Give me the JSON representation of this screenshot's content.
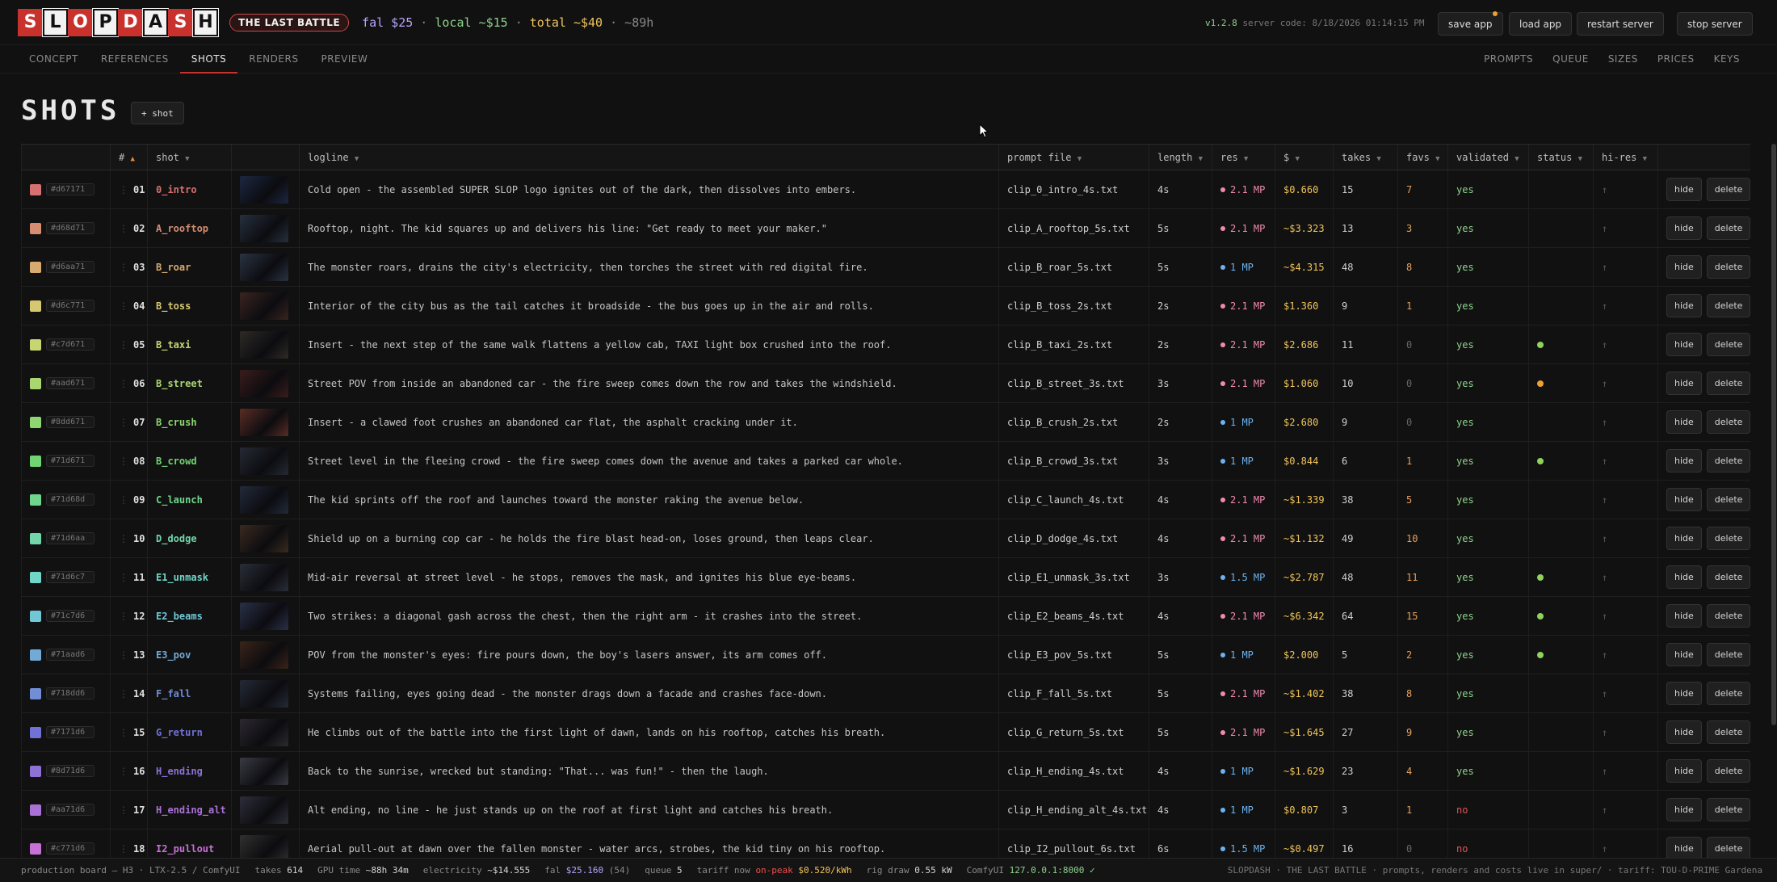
{
  "app": {
    "logo_letters": [
      "S",
      "L",
      "O",
      "P",
      "D",
      "A",
      "S",
      "H"
    ],
    "project_badge": "THE LAST BATTLE",
    "costs": {
      "fal": "fal $25",
      "local": "local ~$15",
      "total": "total ~$40",
      "eta": "~89h"
    },
    "version": "v1.2.8",
    "server_code": "server code: 8/18/2026 01:14:15 PM",
    "buttons": {
      "save": "save app",
      "load": "load app",
      "restart": "restart server",
      "stop": "stop server"
    }
  },
  "nav": {
    "left": [
      "CONCEPT",
      "REFERENCES",
      "SHOTS",
      "RENDERS",
      "PREVIEW"
    ],
    "active": "SHOTS",
    "right": [
      "PROMPTS",
      "QUEUE",
      "SIZES",
      "PRICES",
      "KEYS"
    ]
  },
  "page": {
    "title": "SHOTS",
    "add_button": "+ shot"
  },
  "table": {
    "headers": {
      "num": "#",
      "shot": "shot",
      "logline": "logline",
      "prompt_file": "prompt file",
      "length": "length",
      "res": "res",
      "cost": "$",
      "takes": "takes",
      "favs": "favs",
      "validated": "validated",
      "status": "status",
      "hires": "hi-res"
    },
    "row_buttons": {
      "hide": "hide",
      "delete": "delete"
    },
    "rows": [
      {
        "color": "#d67171",
        "num": "01",
        "shot": "0_intro",
        "thumb": "#1c2740",
        "logline": "Cold open - the assembled SUPER SLOP logo ignites out of the dark, then dissolves into embers.",
        "file": "clip_0_intro_4s.txt",
        "length": "4s",
        "res": "2.1 MP",
        "res_kind": "pink",
        "cost": "$0.660",
        "takes": "15",
        "favs": "7",
        "validated": "yes",
        "status": ""
      },
      {
        "color": "#d68d71",
        "num": "02",
        "shot": "A_rooftop",
        "thumb": "#26303e",
        "logline": "Rooftop, night. The kid squares up and delivers his line: \"Get ready to meet your maker.\"",
        "file": "clip_A_rooftop_5s.txt",
        "length": "5s",
        "res": "2.1 MP",
        "res_kind": "pink",
        "cost": "~$3.323",
        "takes": "13",
        "favs": "3",
        "validated": "yes",
        "status": ""
      },
      {
        "color": "#d6aa71",
        "num": "03",
        "shot": "B_roar",
        "thumb": "#2a3342",
        "logline": "The monster roars, drains the city's electricity, then torches the street with red digital fire.",
        "file": "clip_B_roar_5s.txt",
        "length": "5s",
        "res": "1 MP",
        "res_kind": "blue",
        "cost": "~$4.315",
        "takes": "48",
        "favs": "8",
        "validated": "yes",
        "status": ""
      },
      {
        "color": "#d6c771",
        "num": "04",
        "shot": "B_toss",
        "thumb": "#3a2420",
        "logline": "Interior of the city bus as the tail catches it broadside - the bus goes up in the air and rolls.",
        "file": "clip_B_toss_2s.txt",
        "length": "2s",
        "res": "2.1 MP",
        "res_kind": "pink",
        "cost": "$1.360",
        "takes": "9",
        "favs": "1",
        "validated": "yes",
        "status": ""
      },
      {
        "color": "#c7d671",
        "num": "05",
        "shot": "B_taxi",
        "thumb": "#2e2a26",
        "logline": "Insert - the next step of the same walk flattens a yellow cab, TAXI light box crushed into the roof.",
        "file": "clip_B_taxi_2s.txt",
        "length": "2s",
        "res": "2.1 MP",
        "res_kind": "pink",
        "cost": "$2.686",
        "takes": "11",
        "favs": "0",
        "validated": "yes",
        "status": "#8ed35a"
      },
      {
        "color": "#aad671",
        "num": "06",
        "shot": "B_street",
        "thumb": "#3a1c1c",
        "logline": "Street POV from inside an abandoned car - the fire sweep comes down the row and takes the windshield.",
        "file": "clip_B_street_3s.txt",
        "length": "3s",
        "res": "2.1 MP",
        "res_kind": "pink",
        "cost": "$1.060",
        "takes": "10",
        "favs": "0",
        "validated": "yes",
        "status": "#f0a030"
      },
      {
        "color": "#8dd671",
        "num": "07",
        "shot": "B_crush",
        "thumb": "#5a2c24",
        "logline": "Insert - a clawed foot crushes an abandoned car flat, the asphalt cracking under it.",
        "file": "clip_B_crush_2s.txt",
        "length": "2s",
        "res": "1 MP",
        "res_kind": "blue",
        "cost": "$2.680",
        "takes": "9",
        "favs": "0",
        "validated": "yes",
        "status": ""
      },
      {
        "color": "#71d671",
        "num": "08",
        "shot": "B_crowd",
        "thumb": "#262a34",
        "logline": "Street level in the fleeing crowd - the fire sweep comes down the avenue and takes a parked car whole.",
        "file": "clip_B_crowd_3s.txt",
        "length": "3s",
        "res": "1 MP",
        "res_kind": "blue",
        "cost": "$0.844",
        "takes": "6",
        "favs": "1",
        "validated": "yes",
        "status": "#8ed35a"
      },
      {
        "color": "#71d68d",
        "num": "09",
        "shot": "C_launch",
        "thumb": "#222a3a",
        "logline": "The kid sprints off the roof and launches toward the monster raking the avenue below.",
        "file": "clip_C_launch_4s.txt",
        "length": "4s",
        "res": "2.1 MP",
        "res_kind": "pink",
        "cost": "~$1.339",
        "takes": "38",
        "favs": "5",
        "validated": "yes",
        "status": ""
      },
      {
        "color": "#71d6aa",
        "num": "10",
        "shot": "D_dodge",
        "thumb": "#3a2a1e",
        "logline": "Shield up on a burning cop car - he holds the fire blast head-on, loses ground, then leaps clear.",
        "file": "clip_D_dodge_4s.txt",
        "length": "4s",
        "res": "2.1 MP",
        "res_kind": "pink",
        "cost": "~$1.132",
        "takes": "49",
        "favs": "10",
        "validated": "yes",
        "status": ""
      },
      {
        "color": "#71d6c7",
        "num": "11",
        "shot": "E1_unmask",
        "thumb": "#2a2e38",
        "logline": "Mid-air reversal at street level - he stops, removes the mask, and ignites his blue eye-beams.",
        "file": "clip_E1_unmask_3s.txt",
        "length": "3s",
        "res": "1.5 MP",
        "res_kind": "blue",
        "cost": "~$2.787",
        "takes": "48",
        "favs": "11",
        "validated": "yes",
        "status": "#8ed35a"
      },
      {
        "color": "#71c7d6",
        "num": "12",
        "shot": "E2_beams",
        "thumb": "#2a3048",
        "logline": "Two strikes: a diagonal gash across the chest, then the right arm - it crashes into the street.",
        "file": "clip_E2_beams_4s.txt",
        "length": "4s",
        "res": "2.1 MP",
        "res_kind": "pink",
        "cost": "~$6.342",
        "takes": "64",
        "favs": "15",
        "validated": "yes",
        "status": "#8ed35a"
      },
      {
        "color": "#71aad6",
        "num": "13",
        "shot": "E3_pov",
        "thumb": "#3a2418",
        "logline": "POV from the monster's eyes: fire pours down, the boy's lasers answer, its arm comes off.",
        "file": "clip_E3_pov_5s.txt",
        "length": "5s",
        "res": "1 MP",
        "res_kind": "blue",
        "cost": "$2.000",
        "takes": "5",
        "favs": "2",
        "validated": "yes",
        "status": "#8ed35a"
      },
      {
        "color": "#718dd6",
        "num": "14",
        "shot": "F_fall",
        "thumb": "#242a36",
        "logline": "Systems failing, eyes going dead - the monster drags down a facade and crashes face-down.",
        "file": "clip_F_fall_5s.txt",
        "length": "5s",
        "res": "2.1 MP",
        "res_kind": "pink",
        "cost": "~$1.402",
        "takes": "38",
        "favs": "8",
        "validated": "yes",
        "status": ""
      },
      {
        "color": "#7171d6",
        "num": "15",
        "shot": "G_return",
        "thumb": "#2c2a30",
        "logline": "He climbs out of the battle into the first light of dawn, lands on his rooftop, catches his breath.",
        "file": "clip_G_return_5s.txt",
        "length": "5s",
        "res": "2.1 MP",
        "res_kind": "pink",
        "cost": "~$1.645",
        "takes": "27",
        "favs": "9",
        "validated": "yes",
        "status": ""
      },
      {
        "color": "#8d71d6",
        "num": "16",
        "shot": "H_ending",
        "thumb": "#3a3a44",
        "logline": "Back to the sunrise, wrecked but standing: \"That... was fun!\" - then the laugh.",
        "file": "clip_H_ending_4s.txt",
        "length": "4s",
        "res": "1 MP",
        "res_kind": "blue",
        "cost": "~$1.629",
        "takes": "23",
        "favs": "4",
        "validated": "yes",
        "status": ""
      },
      {
        "color": "#aa71d6",
        "num": "17",
        "shot": "H_ending_alt",
        "thumb": "#2e2e3a",
        "logline": "Alt ending, no line - he just stands up on the roof at first light and catches his breath.",
        "file": "clip_H_ending_alt_4s.txt",
        "length": "4s",
        "res": "1 MP",
        "res_kind": "blue",
        "cost": "$0.807",
        "takes": "3",
        "favs": "1",
        "validated": "no",
        "status": ""
      },
      {
        "color": "#c771d6",
        "num": "18",
        "shot": "I2_pullout",
        "thumb": "#30302e",
        "logline": "Aerial pull-out at dawn over the fallen monster - water arcs, strobes, the kid tiny on his rooftop.",
        "file": "clip_I2_pullout_6s.txt",
        "length": "6s",
        "res": "1.5 MP",
        "res_kind": "blue",
        "cost": "~$0.497",
        "takes": "16",
        "favs": "0",
        "validated": "no",
        "status": ""
      }
    ]
  },
  "footer": {
    "board": "production board — H3 · LTX-2.5 / ComfyUI",
    "takes_label": "takes",
    "takes": "614",
    "gpu_label": "GPU time",
    "gpu": "~88h 34m",
    "elec_label": "electricity",
    "elec": "~$14.555",
    "fal_label": "fal",
    "fal": "$25.160",
    "fal_count": "(54)",
    "queue_label": "queue",
    "queue": "5",
    "tariff_label": "tariff now",
    "tariff_peak": "on-peak",
    "tariff_rate": "$0.520/kWh",
    "rig_label": "rig draw",
    "rig": "0.55 kW",
    "comfy_label": "ComfyUI",
    "comfy": "127.0.0.1:8000 ✓",
    "right": "SLOPDASH · THE LAST BATTLE · prompts, renders and costs live in super/ · tariff: TOU-D-PRIME Gardena"
  }
}
